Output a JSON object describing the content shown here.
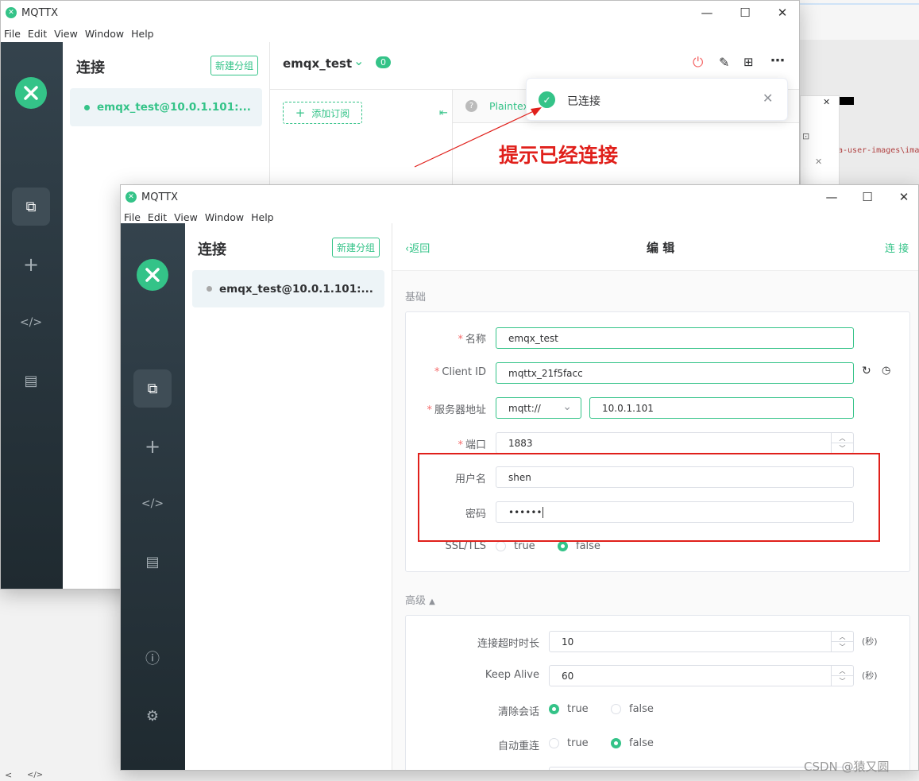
{
  "app": {
    "title": "MQTTX",
    "logo_text": "✕",
    "menu": [
      "File",
      "Edit",
      "View",
      "Window",
      "Help"
    ]
  },
  "back_window": {
    "connections_title": "连接",
    "new_group_label": "新建分组",
    "connection_item": "emqx_test@10.0.1.101:...",
    "header_title": "emqx_test",
    "message_count": "0",
    "add_subscription": "添加订阅",
    "payload_type": "Plaintex",
    "toast_text": "已连接",
    "annotation_text": "提示已经连接"
  },
  "front_window": {
    "connections_title": "连接",
    "new_group_label": "新建分组",
    "connection_item": "emqx_test@10.0.1.101:...",
    "back_label": "返回",
    "page_title": "编 辑",
    "connect_label": "连 接",
    "basic_section": "基础",
    "advanced_section": "高级",
    "fields": {
      "name_label": "名称",
      "name_value": "emqx_test",
      "client_id_label": "Client ID",
      "client_id_value": "mqttx_21f5facc",
      "host_label": "服务器地址",
      "protocol_value": "mqtt://",
      "host_value": "10.0.1.101",
      "port_label": "端口",
      "port_value": "1883",
      "username_label": "用户名",
      "username_value": "shen",
      "password_label": "密码",
      "password_value": "••••••",
      "ssl_label": "SSL/TLS",
      "ssl_true": "true",
      "ssl_false": "false"
    },
    "advanced": {
      "timeout_label": "连接超时时长",
      "timeout_value": "10",
      "timeout_unit": "(秒)",
      "keepalive_label": "Keep Alive",
      "keepalive_value": "60",
      "keepalive_unit": "(秒)",
      "clean_label": "清除会话",
      "clean_true": "true",
      "clean_false": "false",
      "reconnect_label": "自动重连",
      "reconnect_true": "true",
      "reconnect_false": "false"
    }
  },
  "bg_code_snippet": "a-user-images\\ima",
  "watermark": "CSDN @猿又圆",
  "taskbar_icons": [
    "<",
    "</>"
  ],
  "colors": {
    "accent": "#34c388",
    "annotation_red": "#e0201b",
    "sidebar_top": "#34434d",
    "sidebar_bottom": "#1f2a30"
  }
}
